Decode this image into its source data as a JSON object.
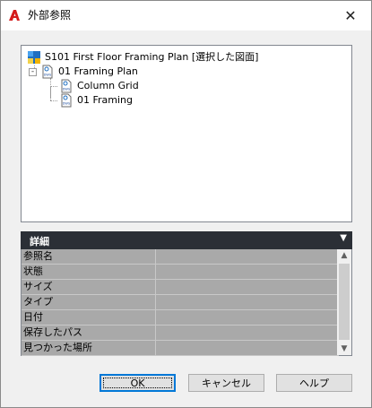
{
  "window": {
    "title": "外部参照"
  },
  "icons": {
    "app": "autocad-a-icon",
    "close": "close-icon",
    "drawing": "drawing-sheet-icon",
    "dwg": "dwg-file-icon",
    "expand": "tree-collapse-icon",
    "details_toggle": "chevron-down-icon"
  },
  "tree": {
    "root": {
      "label": "S101 First Floor Framing Plan [選択した図面]"
    },
    "child": {
      "label": "01 Framing Plan"
    },
    "grandchildren": [
      {
        "label": "Column Grid"
      },
      {
        "label": "01 Framing"
      }
    ]
  },
  "details": {
    "title": "詳細",
    "properties": [
      {
        "name": "参照名",
        "value": ""
      },
      {
        "name": "状態",
        "value": ""
      },
      {
        "name": "サイズ",
        "value": ""
      },
      {
        "name": "タイプ",
        "value": ""
      },
      {
        "name": "日付",
        "value": ""
      },
      {
        "name": "保存したパス",
        "value": ""
      },
      {
        "name": "見つかった場所",
        "value": ""
      }
    ]
  },
  "buttons": {
    "ok": "OK",
    "cancel": "キャンセル",
    "help": "ヘルプ"
  },
  "colors": {
    "accent": "#0078d7",
    "details_header": "#2b2f36",
    "property_cell": "#a9a9a9",
    "autocad_red": "#d41b1b"
  }
}
